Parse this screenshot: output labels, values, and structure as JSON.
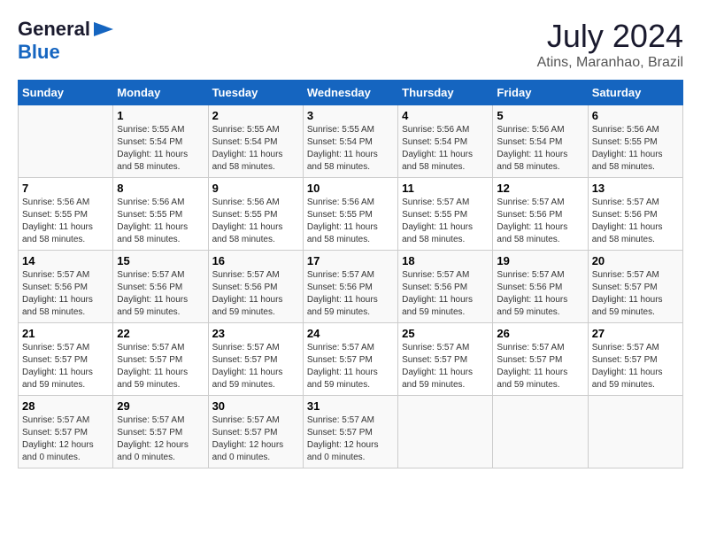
{
  "header": {
    "logo_general": "General",
    "logo_blue": "Blue",
    "month_year": "July 2024",
    "location": "Atins, Maranhao, Brazil"
  },
  "days_of_week": [
    "Sunday",
    "Monday",
    "Tuesday",
    "Wednesday",
    "Thursday",
    "Friday",
    "Saturday"
  ],
  "weeks": [
    [
      {
        "day": "",
        "info": ""
      },
      {
        "day": "1",
        "info": "Sunrise: 5:55 AM\nSunset: 5:54 PM\nDaylight: 11 hours and 58 minutes."
      },
      {
        "day": "2",
        "info": "Sunrise: 5:55 AM\nSunset: 5:54 PM\nDaylight: 11 hours and 58 minutes."
      },
      {
        "day": "3",
        "info": "Sunrise: 5:55 AM\nSunset: 5:54 PM\nDaylight: 11 hours and 58 minutes."
      },
      {
        "day": "4",
        "info": "Sunrise: 5:56 AM\nSunset: 5:54 PM\nDaylight: 11 hours and 58 minutes."
      },
      {
        "day": "5",
        "info": "Sunrise: 5:56 AM\nSunset: 5:54 PM\nDaylight: 11 hours and 58 minutes."
      },
      {
        "day": "6",
        "info": "Sunrise: 5:56 AM\nSunset: 5:55 PM\nDaylight: 11 hours and 58 minutes."
      }
    ],
    [
      {
        "day": "7",
        "info": "Sunrise: 5:56 AM\nSunset: 5:55 PM\nDaylight: 11 hours and 58 minutes."
      },
      {
        "day": "8",
        "info": "Sunrise: 5:56 AM\nSunset: 5:55 PM\nDaylight: 11 hours and 58 minutes."
      },
      {
        "day": "9",
        "info": "Sunrise: 5:56 AM\nSunset: 5:55 PM\nDaylight: 11 hours and 58 minutes."
      },
      {
        "day": "10",
        "info": "Sunrise: 5:56 AM\nSunset: 5:55 PM\nDaylight: 11 hours and 58 minutes."
      },
      {
        "day": "11",
        "info": "Sunrise: 5:57 AM\nSunset: 5:55 PM\nDaylight: 11 hours and 58 minutes."
      },
      {
        "day": "12",
        "info": "Sunrise: 5:57 AM\nSunset: 5:56 PM\nDaylight: 11 hours and 58 minutes."
      },
      {
        "day": "13",
        "info": "Sunrise: 5:57 AM\nSunset: 5:56 PM\nDaylight: 11 hours and 58 minutes."
      }
    ],
    [
      {
        "day": "14",
        "info": "Sunrise: 5:57 AM\nSunset: 5:56 PM\nDaylight: 11 hours and 58 minutes."
      },
      {
        "day": "15",
        "info": "Sunrise: 5:57 AM\nSunset: 5:56 PM\nDaylight: 11 hours and 59 minutes."
      },
      {
        "day": "16",
        "info": "Sunrise: 5:57 AM\nSunset: 5:56 PM\nDaylight: 11 hours and 59 minutes."
      },
      {
        "day": "17",
        "info": "Sunrise: 5:57 AM\nSunset: 5:56 PM\nDaylight: 11 hours and 59 minutes."
      },
      {
        "day": "18",
        "info": "Sunrise: 5:57 AM\nSunset: 5:56 PM\nDaylight: 11 hours and 59 minutes."
      },
      {
        "day": "19",
        "info": "Sunrise: 5:57 AM\nSunset: 5:56 PM\nDaylight: 11 hours and 59 minutes."
      },
      {
        "day": "20",
        "info": "Sunrise: 5:57 AM\nSunset: 5:57 PM\nDaylight: 11 hours and 59 minutes."
      }
    ],
    [
      {
        "day": "21",
        "info": "Sunrise: 5:57 AM\nSunset: 5:57 PM\nDaylight: 11 hours and 59 minutes."
      },
      {
        "day": "22",
        "info": "Sunrise: 5:57 AM\nSunset: 5:57 PM\nDaylight: 11 hours and 59 minutes."
      },
      {
        "day": "23",
        "info": "Sunrise: 5:57 AM\nSunset: 5:57 PM\nDaylight: 11 hours and 59 minutes."
      },
      {
        "day": "24",
        "info": "Sunrise: 5:57 AM\nSunset: 5:57 PM\nDaylight: 11 hours and 59 minutes."
      },
      {
        "day": "25",
        "info": "Sunrise: 5:57 AM\nSunset: 5:57 PM\nDaylight: 11 hours and 59 minutes."
      },
      {
        "day": "26",
        "info": "Sunrise: 5:57 AM\nSunset: 5:57 PM\nDaylight: 11 hours and 59 minutes."
      },
      {
        "day": "27",
        "info": "Sunrise: 5:57 AM\nSunset: 5:57 PM\nDaylight: 11 hours and 59 minutes."
      }
    ],
    [
      {
        "day": "28",
        "info": "Sunrise: 5:57 AM\nSunset: 5:57 PM\nDaylight: 12 hours and 0 minutes."
      },
      {
        "day": "29",
        "info": "Sunrise: 5:57 AM\nSunset: 5:57 PM\nDaylight: 12 hours and 0 minutes."
      },
      {
        "day": "30",
        "info": "Sunrise: 5:57 AM\nSunset: 5:57 PM\nDaylight: 12 hours and 0 minutes."
      },
      {
        "day": "31",
        "info": "Sunrise: 5:57 AM\nSunset: 5:57 PM\nDaylight: 12 hours and 0 minutes."
      },
      {
        "day": "",
        "info": ""
      },
      {
        "day": "",
        "info": ""
      },
      {
        "day": "",
        "info": ""
      }
    ]
  ]
}
